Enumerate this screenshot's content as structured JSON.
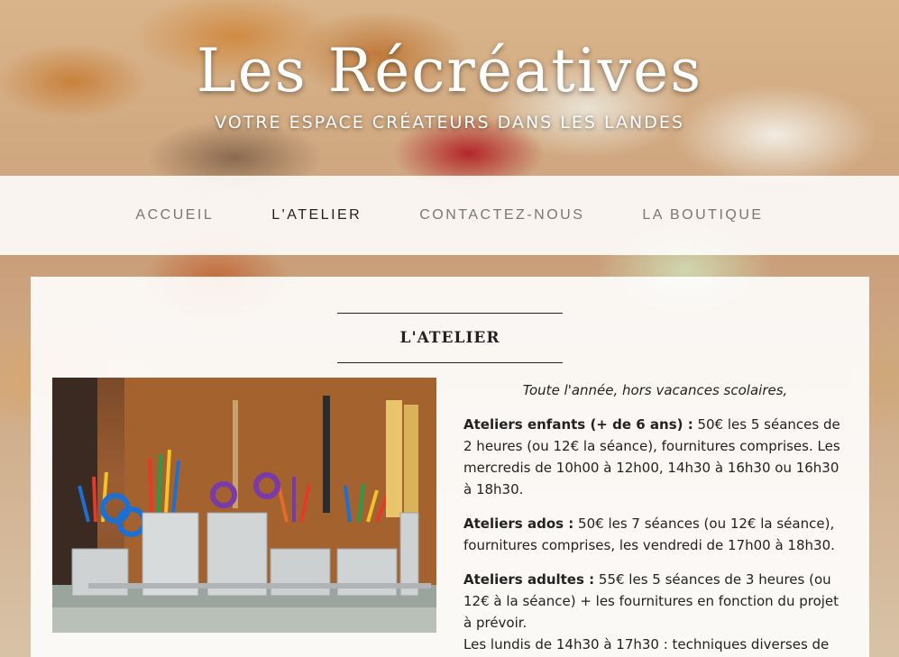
{
  "header": {
    "title": "Les Récréatives",
    "tagline": "VOTRE ESPACE CRÉATEURS DANS LES LANDES"
  },
  "nav": {
    "items": [
      {
        "label": "ACCUEIL",
        "active": false
      },
      {
        "label": "L'ATELIER",
        "active": true
      },
      {
        "label": "CONTACTEZ-NOUS",
        "active": false
      },
      {
        "label": "LA BOUTIQUE",
        "active": false
      }
    ]
  },
  "main": {
    "heading": "L'ATELIER",
    "intro": "Toute l'année, hors vacances scolaires,",
    "sections": [
      {
        "label": "Ateliers enfants (+ de 6 ans) :",
        "text": " 50€ les 5 séances de 2 heures (ou 12€ la séance), fournitures comprises. Les mercredis de 10h00 à 12h00, 14h30 à 16h30 ou 16h30 à 18h30."
      },
      {
        "label": "Ateliers ados :",
        "text": " 50€ les 7 séances (ou 12€ la séance), fournitures comprises, les vendredi de 17h00 à 18h30."
      },
      {
        "label": "Ateliers adultes :",
        "text": " 55€ les 5 séances de 3 heures (ou 12€ à la séance) + les fournitures en fonction du projet à prévoir.",
        "extra": "Les lundis de 14h30 à 17h30 : techniques diverses de"
      }
    ]
  },
  "colors": {
    "nav_active": "#222222",
    "nav_inactive": "#777777",
    "text": "#222222"
  }
}
